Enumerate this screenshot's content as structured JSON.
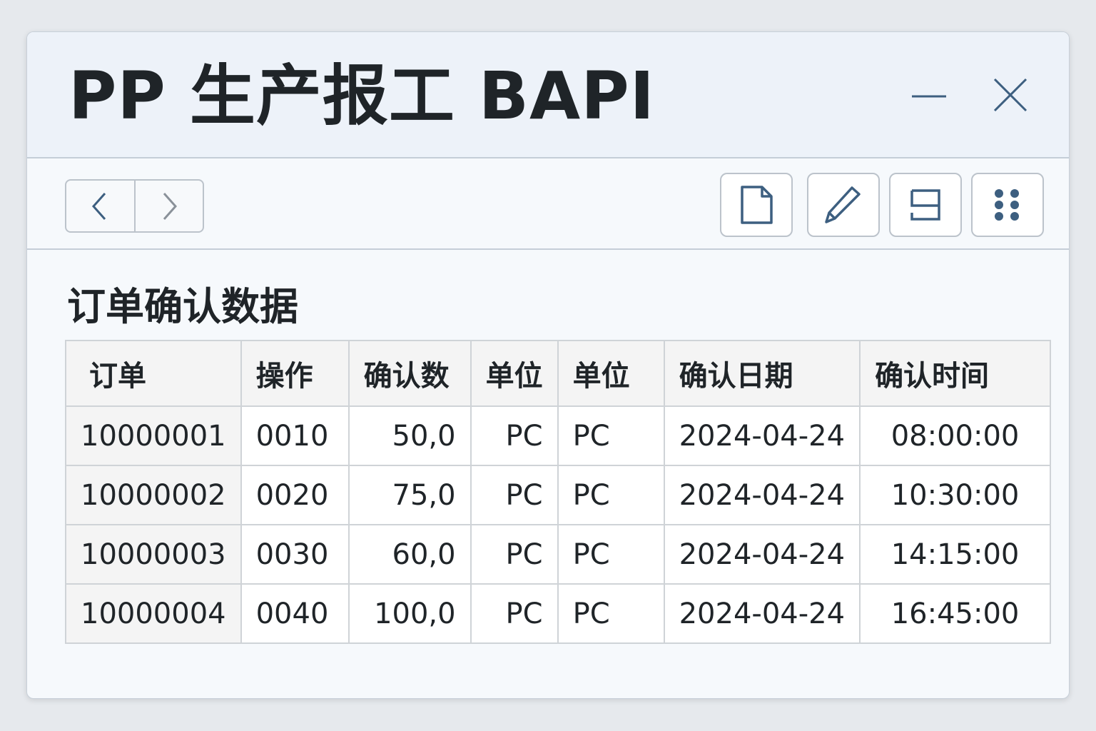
{
  "window": {
    "title": "PP 生产报工 BAPI"
  },
  "section_title": "订单确认数据",
  "table": {
    "headers": [
      "订单",
      "操作",
      "确认数",
      "单位",
      "单位",
      "确认日期",
      "确认时间"
    ],
    "rows": [
      [
        "10000001",
        "0010",
        "50,0",
        "PC",
        "PC",
        "2024-04-24",
        "08:00:00"
      ],
      [
        "10000002",
        "0020",
        "75,0",
        "PC",
        "PC",
        "2024-04-24",
        "10:30:00"
      ],
      [
        "10000003",
        "0030",
        "60,0",
        "PC",
        "PC",
        "2024-04-24",
        "14:15:00"
      ],
      [
        "10000004",
        "0040",
        "100,0",
        "PC",
        "PC",
        "2024-04-24",
        "16:45:00"
      ]
    ]
  },
  "icons": [
    "minimize-icon",
    "close-icon",
    "chevron-left-icon",
    "chevron-right-icon",
    "document-icon",
    "pencil-icon",
    "layout-icon",
    "grid-dots-icon"
  ],
  "colors": {
    "icon": "#3d5f80",
    "titlebar": "#edf2f9"
  }
}
